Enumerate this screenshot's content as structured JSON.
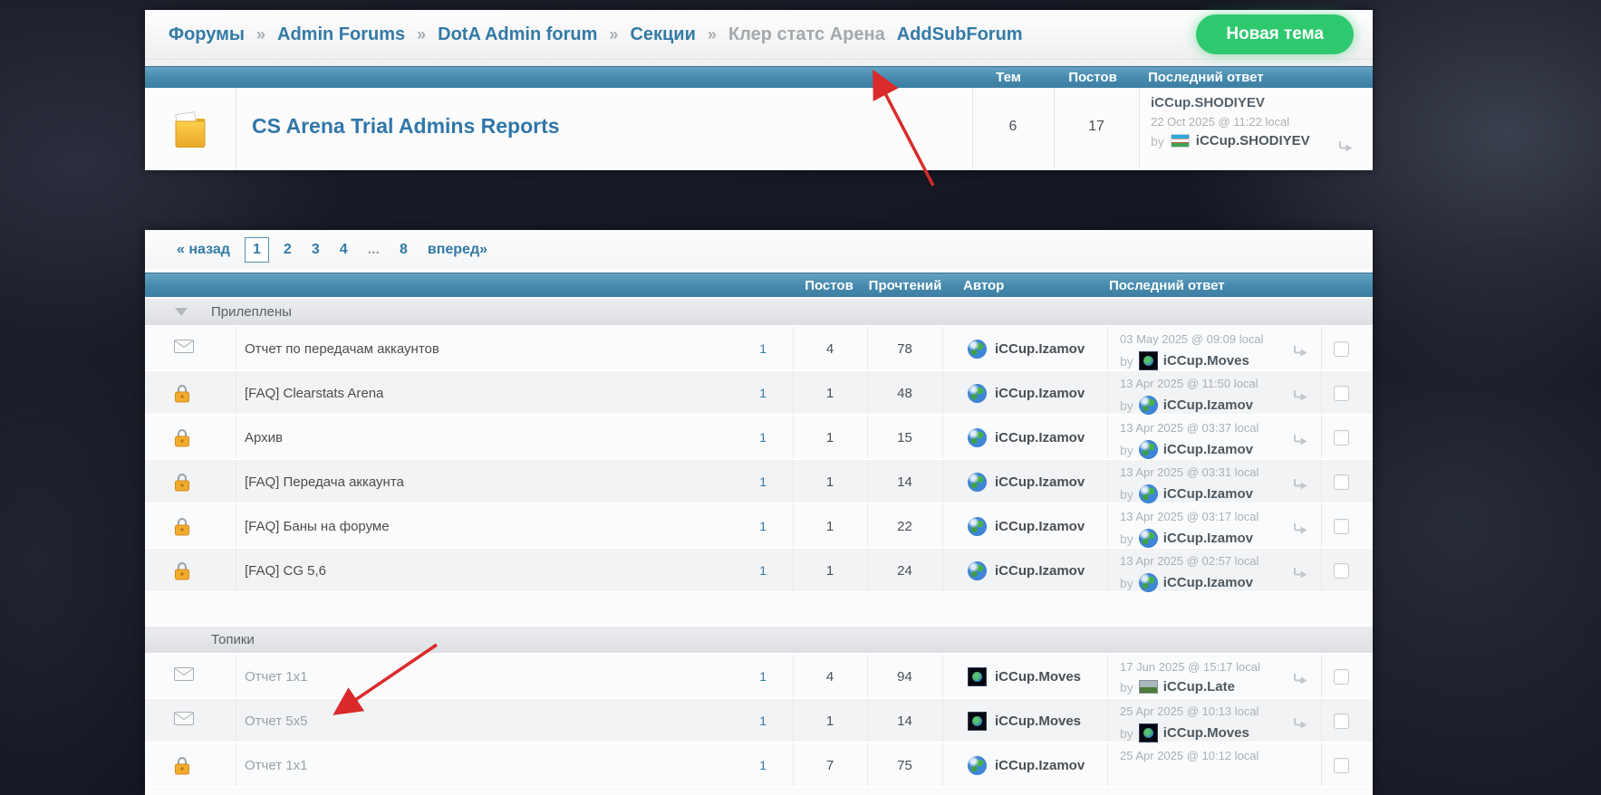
{
  "colors": {
    "link_blue": "#337ba6",
    "header_blue": "#4589ad",
    "accent_green": "#2ec96f",
    "annotation_red": "#d92b2b"
  },
  "breadcrumb": {
    "links": [
      "Форумы",
      "Admin Forums",
      "DotA Admin forum",
      "Секции"
    ],
    "separator": "»",
    "current": "Клер статс Арена",
    "action_link": "AddSubForum"
  },
  "new_topic_button": "Новая тема",
  "subforum_table": {
    "headers": {
      "topics": "Тем",
      "posts": "Постов",
      "last_reply": "Последний ответ"
    },
    "row": {
      "icon": "folder",
      "title": "CS Arena Trial Admins Reports",
      "topics": "6",
      "posts": "17",
      "last": {
        "name": "iCCup.SHODIYEV",
        "date": "22 Oct 2025 @ 11:22 local",
        "by_label": "by",
        "by_name": "iCCup.SHODIYEV",
        "by_avatar": "uz-flag"
      }
    }
  },
  "pagination": {
    "prev": "« назад",
    "pages": [
      "1",
      "2",
      "3",
      "4",
      "...",
      "8"
    ],
    "current": "1",
    "next": "вперед»"
  },
  "topics_table": {
    "headers": {
      "posts": "Постов",
      "reads": "Прочтений",
      "author": "Автор",
      "last_reply": "Последний ответ"
    },
    "by_label": "by",
    "sections": [
      {
        "label": "Прилеплены",
        "collapsible": true,
        "topics": [
          {
            "icon": "envelope",
            "pinned": true,
            "title": "Отчет по передачам аккаунтов",
            "page": "1",
            "posts": "4",
            "reads": "78",
            "author": {
              "name": "iCCup.Izamov",
              "avatar": "globe"
            },
            "last": {
              "date": "03 May 2025 @ 09:09 local",
              "by_name": "iCCup.Moves",
              "by_avatar": "dark-globe"
            }
          },
          {
            "icon": "lock",
            "pinned": true,
            "title": "[FAQ] Clearstats Arena",
            "page": "1",
            "posts": "1",
            "reads": "48",
            "author": {
              "name": "iCCup.Izamov",
              "avatar": "globe"
            },
            "last": {
              "date": "13 Apr 2025 @ 11:50 local",
              "by_name": "iCCup.Izamov",
              "by_avatar": "globe"
            }
          },
          {
            "icon": "lock",
            "pinned": true,
            "title": "Архив",
            "page": "1",
            "posts": "1",
            "reads": "15",
            "author": {
              "name": "iCCup.Izamov",
              "avatar": "globe"
            },
            "last": {
              "date": "13 Apr 2025 @ 03:37 local",
              "by_name": "iCCup.Izamov",
              "by_avatar": "globe"
            }
          },
          {
            "icon": "lock",
            "pinned": true,
            "title": "[FAQ] Передача аккаунта",
            "page": "1",
            "posts": "1",
            "reads": "14",
            "author": {
              "name": "iCCup.Izamov",
              "avatar": "globe"
            },
            "last": {
              "date": "13 Apr 2025 @ 03:31 local",
              "by_name": "iCCup.Izamov",
              "by_avatar": "globe"
            }
          },
          {
            "icon": "lock",
            "pinned": true,
            "title": "[FAQ] Баны на форуме",
            "page": "1",
            "posts": "1",
            "reads": "22",
            "author": {
              "name": "iCCup.Izamov",
              "avatar": "globe"
            },
            "last": {
              "date": "13 Apr 2025 @ 03:17 local",
              "by_name": "iCCup.Izamov",
              "by_avatar": "globe"
            }
          },
          {
            "icon": "lock",
            "pinned": true,
            "title": "[FAQ] CG 5,6",
            "page": "1",
            "posts": "1",
            "reads": "24",
            "author": {
              "name": "iCCup.Izamov",
              "avatar": "globe"
            },
            "last": {
              "date": "13 Apr 2025 @ 02:57 local",
              "by_name": "iCCup.Izamov",
              "by_avatar": "globe"
            }
          }
        ]
      },
      {
        "label": "Топики",
        "collapsible": false,
        "topics": [
          {
            "icon": "envelope",
            "pinned": false,
            "title": "Отчет 1x1",
            "page": "1",
            "posts": "4",
            "reads": "94",
            "author": {
              "name": "iCCup.Moves",
              "avatar": "dark-globe"
            },
            "last": {
              "date": "17 Jun 2025 @ 15:17 local",
              "by_name": "iCCup.Late",
              "by_avatar": "photo"
            }
          },
          {
            "icon": "envelope",
            "pinned": false,
            "title": "Отчет 5x5",
            "page": "1",
            "posts": "1",
            "reads": "14",
            "author": {
              "name": "iCCup.Moves",
              "avatar": "dark-globe"
            },
            "last": {
              "date": "25 Apr 2025 @ 10:13 local",
              "by_name": "iCCup.Moves",
              "by_avatar": "dark-globe"
            }
          },
          {
            "icon": "lock",
            "pinned": false,
            "title": "Отчет 1x1",
            "page": "1",
            "posts": "7",
            "reads": "75",
            "author": {
              "name": "iCCup.Izamov",
              "avatar": "globe"
            },
            "last": {
              "date": "25 Apr 2025 @ 10:12 local",
              "by_name": "",
              "by_avatar": ""
            }
          }
        ]
      }
    ]
  }
}
